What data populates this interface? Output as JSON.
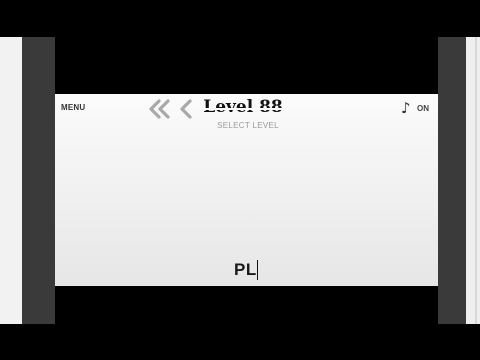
{
  "header": {
    "menu_label": "MENU",
    "level_title": "Level 88",
    "level_subtitle": "SELECT LEVEL",
    "sound_state": "ON"
  },
  "icons": {
    "first": "double-chevron-left-icon",
    "prev": "chevron-left-icon",
    "sound": "music-note-icon"
  },
  "game_area": {
    "typed_text": "PL"
  },
  "colors": {
    "frame": "#3a3a3a",
    "background": "#000000",
    "chevron": "#a9a9a9"
  }
}
